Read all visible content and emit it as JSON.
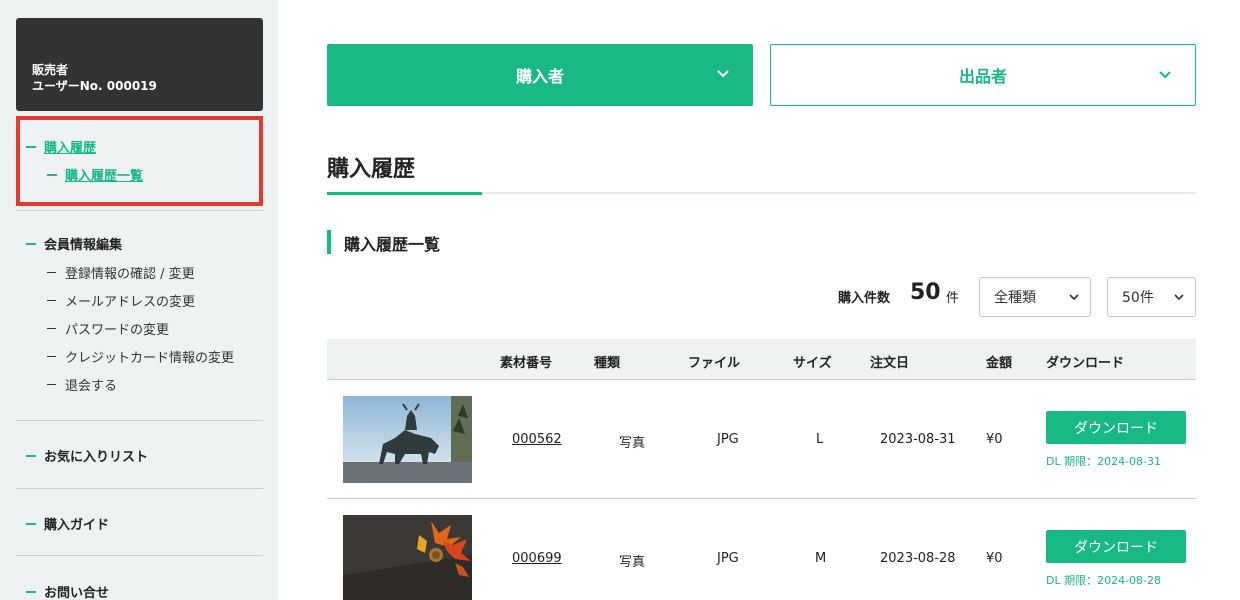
{
  "sidebar": {
    "role": "販売者",
    "user_no": "ユーザーNo. 000019",
    "history": "購入履歴",
    "history_list": "購入履歴一覧",
    "member_edit": "会員情報編集",
    "member_items": [
      "登録情報の確認 / 変更",
      "メールアドレスの変更",
      "パスワードの変更",
      "クレジットカード情報の変更",
      "退会する"
    ],
    "favorites": "お気に入りリスト",
    "guide": "購入ガイド",
    "contact": "お問い合せ"
  },
  "tabs": {
    "buyer": "購入者",
    "seller": "出品者"
  },
  "page": {
    "title": "購入履歴",
    "section": "購入履歴一覧",
    "count_label": "購入件数",
    "count": "50",
    "count_unit": "件",
    "filter_type": "全種類",
    "per_page": "50件"
  },
  "table": {
    "headers": [
      "素材番号",
      "種類",
      "ファイル",
      "サイズ",
      "注文日",
      "金額",
      "ダウンロード"
    ],
    "rows": [
      {
        "id": "000562",
        "type": "写真",
        "file": "JPG",
        "size": "L",
        "date": "2023-08-31",
        "price": "¥0",
        "download": "ダウンロード",
        "limit": "DL 期限：2024-08-31"
      },
      {
        "id": "000699",
        "type": "写真",
        "file": "JPG",
        "size": "M",
        "date": "2023-08-28",
        "price": "¥0",
        "download": "ダウンロード",
        "limit": "DL 期限：2024-08-28"
      }
    ]
  },
  "colors": {
    "accent": "#19b985",
    "highlight": "#e53b2f",
    "dark": "#333333"
  }
}
